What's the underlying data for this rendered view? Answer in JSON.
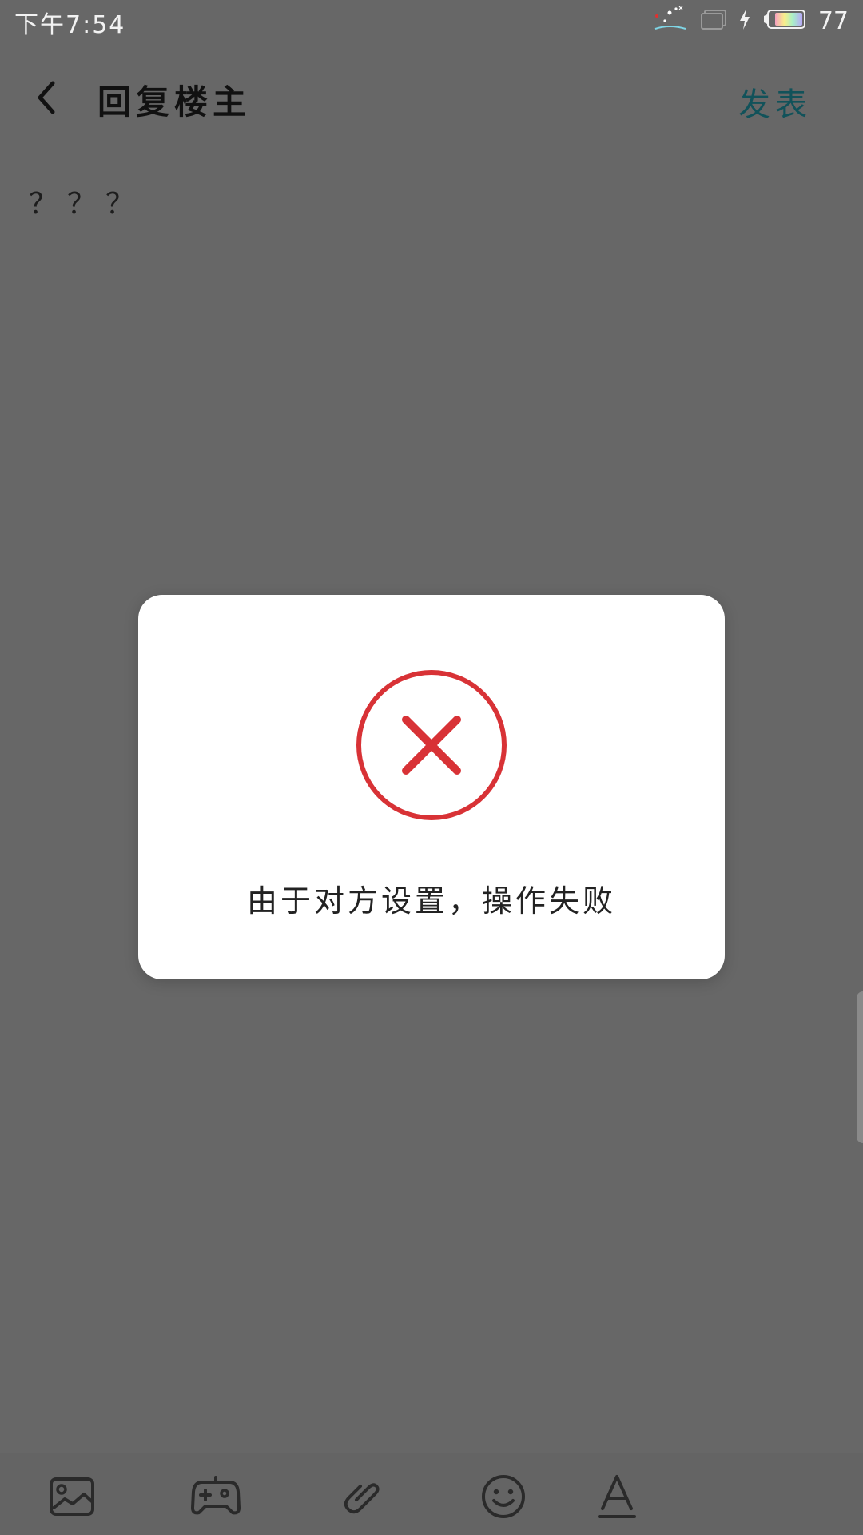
{
  "status_bar": {
    "time": "下午7:54",
    "battery_level": "77",
    "icons": [
      "notification-sparkle-icon",
      "screen-mirror-icon",
      "charging-bolt-icon",
      "battery-icon"
    ]
  },
  "header": {
    "back_icon": "chevron-left-icon",
    "title": "回复楼主",
    "publish_label": "发表"
  },
  "editor": {
    "content": "？？？"
  },
  "dialog": {
    "icon": "error-circle-x-icon",
    "message": "由于对方设置，操作失败"
  },
  "toolbar": {
    "items": [
      {
        "icon": "image-icon"
      },
      {
        "icon": "gamepad-icon"
      },
      {
        "icon": "link-icon"
      },
      {
        "icon": "emoji-icon"
      },
      {
        "icon": "text-format-icon"
      }
    ]
  },
  "colors": {
    "overlay_background": "#676767",
    "publish_accent": "#11525a",
    "error_red": "#d83236",
    "dialog_background": "#ffffff"
  }
}
